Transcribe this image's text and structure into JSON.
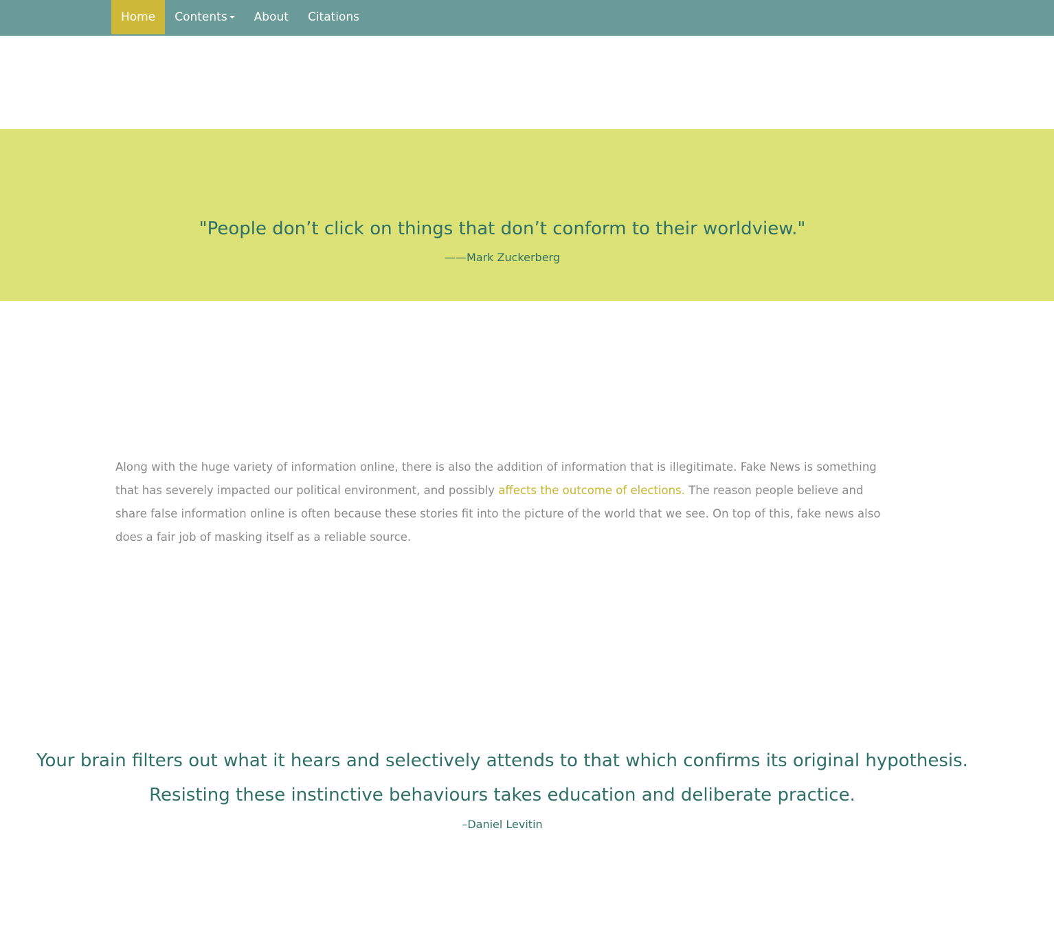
{
  "nav": {
    "items": [
      {
        "label": "Home"
      },
      {
        "label": "Contents"
      },
      {
        "label": "About"
      },
      {
        "label": "Citations"
      }
    ]
  },
  "banner": {
    "quote": "\"People don’t click on things that don’t conform to their worldview.\"",
    "author": "——Mark Zuckerberg"
  },
  "intro": {
    "text_before": "Along with the huge variety of information online, there is also the addition of information that is illegitimate. Fake News is something that has severely impacted our political environment, and possibly ",
    "link_text": "affects the outcome of elections.",
    "text_after": " The reason people believe and share false information online is often because these stories fit into the picture of the world that we see. On top of this, fake news also does a fair job of masking itself as a reliable source."
  },
  "second_quote": {
    "line1": "Your brain filters out what it hears and selectively attends to that which confirms its original hypothesis.",
    "line2": "Resisting these instinctive behaviours takes education and deliberate practice.",
    "author": "–Daniel Levitin"
  },
  "colors": {
    "navbar": "#6a9b98",
    "nav_active": "#cdb937",
    "banner": "#dce275",
    "quote_text": "#2f7068",
    "body_text": "#8a8a8a",
    "link": "#c8b52e"
  }
}
